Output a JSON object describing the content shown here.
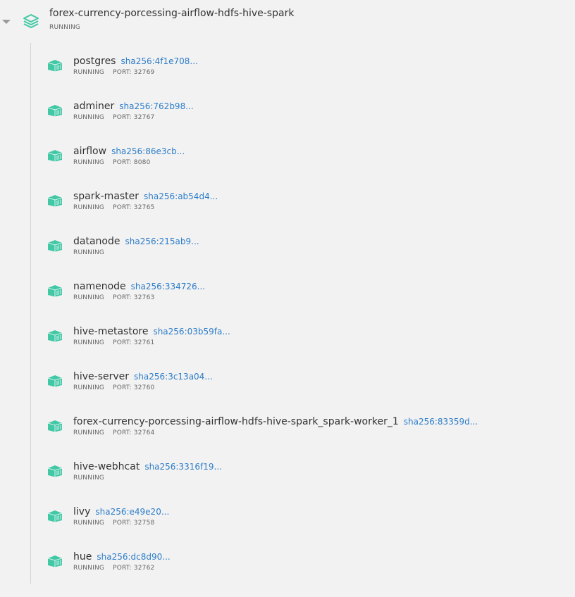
{
  "stack": {
    "name": "forex-currency-porcessing-airflow-hdfs-hive-spark",
    "status": "RUNNING",
    "icon": "layers-icon",
    "expand_icon": "caret-down-icon"
  },
  "accent_color": "#43c8a6",
  "hash_color": "#2d7dc9",
  "containers": [
    {
      "name": "postgres",
      "hash": "sha256:4f1e708...",
      "status": "RUNNING",
      "port": "PORT: 32769"
    },
    {
      "name": "adminer",
      "hash": "sha256:762b98...",
      "status": "RUNNING",
      "port": "PORT: 32767"
    },
    {
      "name": "airflow",
      "hash": "sha256:86e3cb...",
      "status": "RUNNING",
      "port": "PORT: 8080"
    },
    {
      "name": "spark-master",
      "hash": "sha256:ab54d4...",
      "status": "RUNNING",
      "port": "PORT: 32765"
    },
    {
      "name": "datanode",
      "hash": "sha256:215ab9...",
      "status": "RUNNING",
      "port": ""
    },
    {
      "name": "namenode",
      "hash": "sha256:334726...",
      "status": "RUNNING",
      "port": "PORT: 32763"
    },
    {
      "name": "hive-metastore",
      "hash": "sha256:03b59fa...",
      "status": "RUNNING",
      "port": "PORT: 32761"
    },
    {
      "name": "hive-server",
      "hash": "sha256:3c13a04...",
      "status": "RUNNING",
      "port": "PORT: 32760"
    },
    {
      "name": "forex-currency-porcessing-airflow-hdfs-hive-spark_spark-worker_1",
      "hash": "sha256:83359d...",
      "status": "RUNNING",
      "port": "PORT: 32764"
    },
    {
      "name": "hive-webhcat",
      "hash": "sha256:3316f19...",
      "status": "RUNNING",
      "port": ""
    },
    {
      "name": "livy",
      "hash": "sha256:e49e20...",
      "status": "RUNNING",
      "port": "PORT: 32758"
    },
    {
      "name": "hue",
      "hash": "sha256:dc8d90...",
      "status": "RUNNING",
      "port": "PORT: 32762"
    }
  ]
}
